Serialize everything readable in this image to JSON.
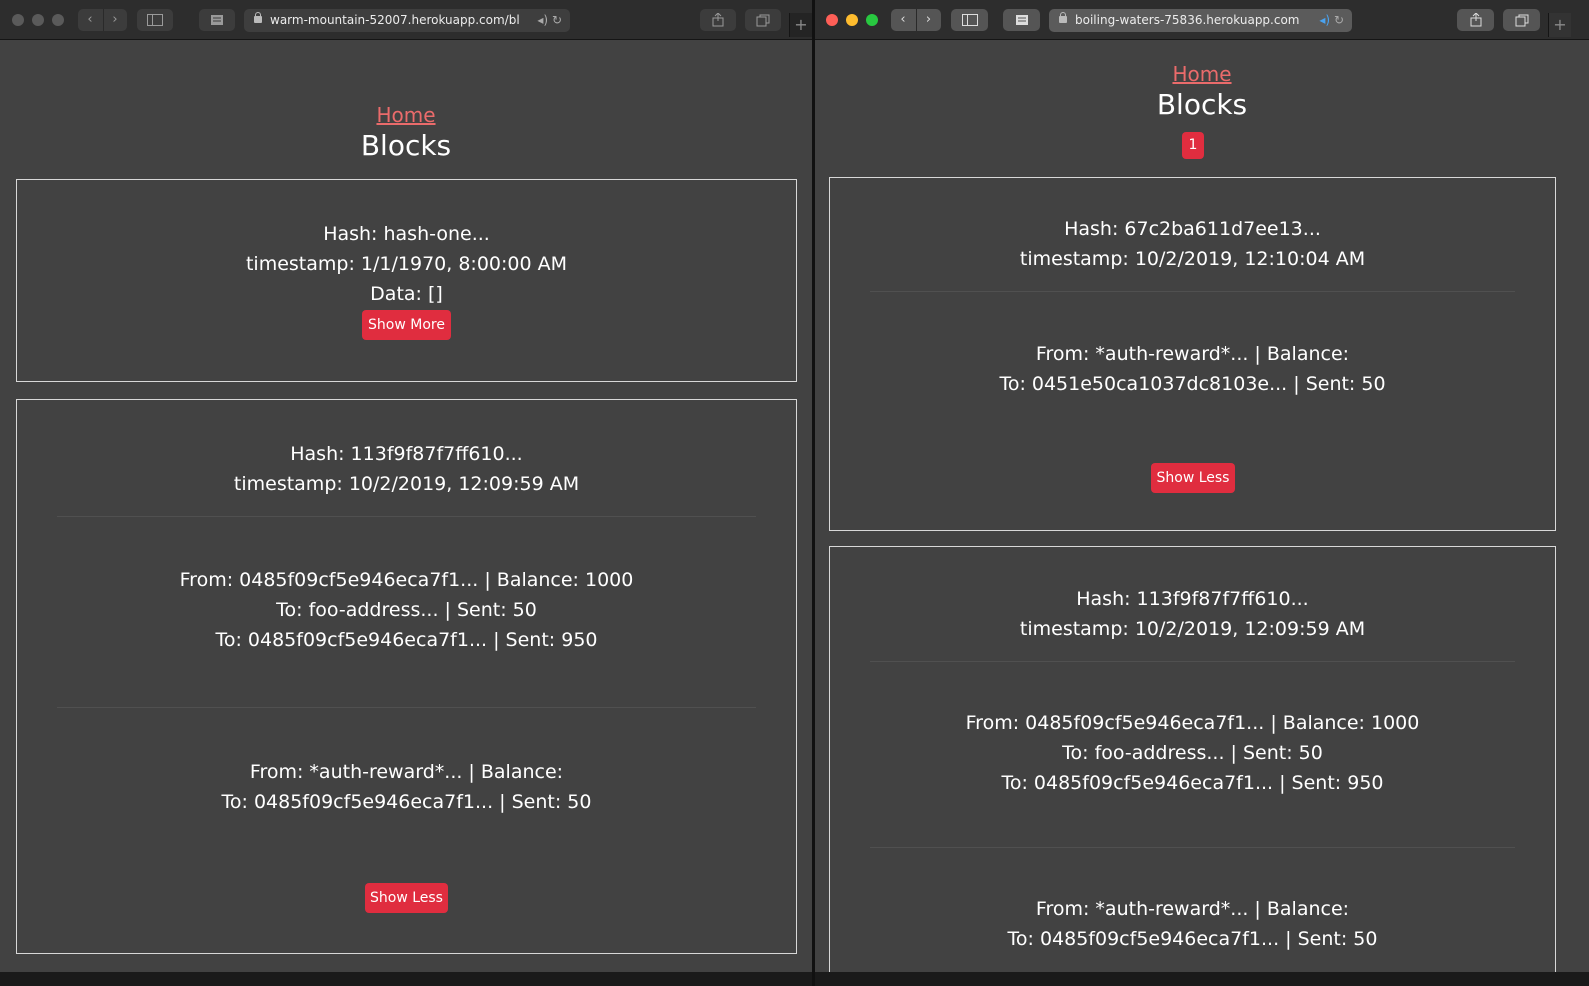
{
  "left_window": {
    "url": "warm-mountain-52007.herokuapp.com/bl",
    "home_link": "Home",
    "title": "Blocks",
    "blocks": [
      {
        "hash": "Hash: hash-one...",
        "timestamp": "timestamp: 1/1/1970, 8:00:00 AM",
        "data": "Data: []",
        "button": "Show More"
      },
      {
        "hash": "Hash: 113f9f87f7ff610...",
        "timestamp": "timestamp: 10/2/2019, 12:09:59 AM",
        "transactions": [
          {
            "from": "From: 0485f09cf5e946eca7f1... | Balance: 1000",
            "to": [
              "To: foo-address... | Sent: 50",
              "To: 0485f09cf5e946eca7f1... | Sent: 950"
            ]
          },
          {
            "from": "From: *auth-reward*... | Balance:",
            "to": [
              "To: 0485f09cf5e946eca7f1... | Sent: 50"
            ]
          }
        ],
        "button": "Show Less"
      }
    ]
  },
  "right_window": {
    "url": "boiling-waters-75836.herokuapp.com",
    "home_link": "Home",
    "title": "Blocks",
    "page_button": "1",
    "blocks": [
      {
        "hash": "Hash: 67c2ba611d7ee13...",
        "timestamp": "timestamp: 10/2/2019, 12:10:04 AM",
        "transactions": [
          {
            "from": "From: *auth-reward*... | Balance:",
            "to": [
              "To: 0451e50ca1037dc8103e... | Sent: 50"
            ]
          }
        ],
        "button": "Show Less"
      },
      {
        "hash": "Hash: 113f9f87f7ff610...",
        "timestamp": "timestamp: 10/2/2019, 12:09:59 AM",
        "transactions": [
          {
            "from": "From: 0485f09cf5e946eca7f1... | Balance: 1000",
            "to": [
              "To: foo-address... | Sent: 50",
              "To: 0485f09cf5e946eca7f1... | Sent: 950"
            ]
          },
          {
            "from": "From: *auth-reward*... | Balance:",
            "to": [
              "To: 0485f09cf5e946eca7f1... | Sent: 50"
            ]
          }
        ]
      }
    ]
  },
  "icons": {
    "back": "‹",
    "forward": "›",
    "new_tab": "+",
    "reload": "↻"
  }
}
